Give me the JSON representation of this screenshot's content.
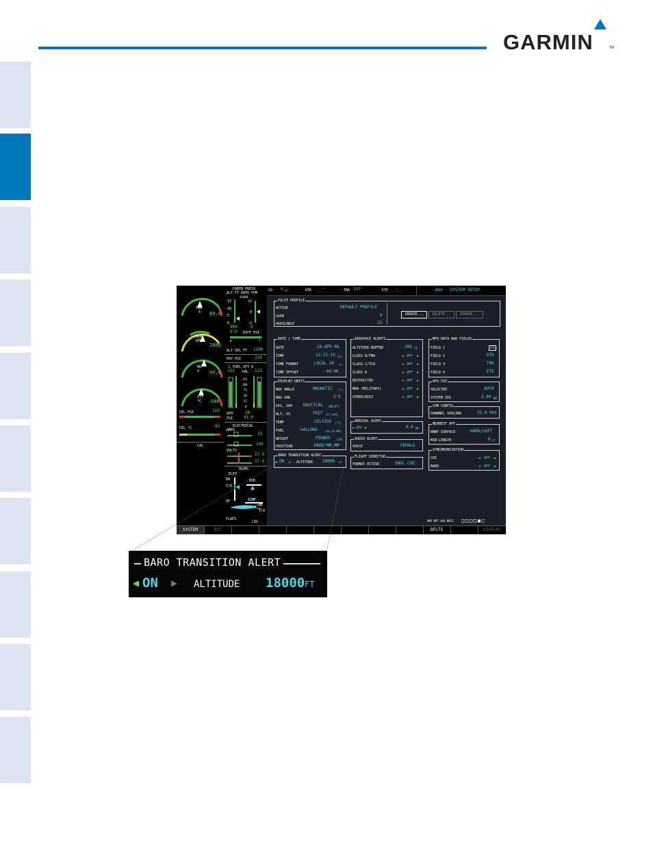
{
  "brand": {
    "logo_text": "GARMIN",
    "trademark": "TM",
    "accent_color": "#0077bd"
  },
  "topbar": {
    "gs_label": "GS",
    "gs_value": "0",
    "gs_unit": "KT",
    "dtk_label": "DTK",
    "dtk_value": "___°",
    "trk_label": "TRK",
    "trk_value": "357°",
    "ete_label": "ETE",
    "ete_value": "__:__",
    "page_title": "AUX - SYSTEM SETUP"
  },
  "eis": {
    "trq": {
      "label": "TRQ",
      "unit": "%",
      "value": "80.0"
    },
    "prop": {
      "label": "PROP",
      "unit": "RPM",
      "value": "2000"
    },
    "ng": {
      "label": "NG",
      "unit": "%",
      "value": "99.0"
    },
    "itt": {
      "label": "ITT",
      "unit": "°C",
      "value": "600"
    },
    "oil_psi": {
      "label": "OIL PSI",
      "value": "110"
    },
    "oil_c": {
      "label": "OIL °C",
      "value": "85"
    },
    "cas_label": "CAS"
  },
  "eis2": {
    "cabin_press": "CABIN PRESS",
    "alt_ft_rate_fpm": "ALT FT RATE FPM",
    "scale_top": "41000",
    "alt_ticks": [
      "15",
      "10",
      "5",
      "0"
    ],
    "rate_ticks": [
      "+2",
      "0",
      "-2"
    ],
    "alt_value": "900",
    "rate_value": "0",
    "diff_psi_value": "0.0",
    "diff_psi_label": "DIFF PSI",
    "diff_scale_low": "0",
    "diff_scale_high": "7",
    "alt_sel_label": "ALT SEL FT",
    "alt_sel_value": "1100",
    "oxy_psi_label": "OXY PSI",
    "oxy_psi_value": "330",
    "fuel_qty_label": "L  FUEL QTY  R",
    "fuel_unit": "GAL",
    "fuel_left": "122",
    "fuel_right": "122",
    "fuel_ticks": [
      "125",
      "100",
      "75",
      "50",
      "25",
      "0"
    ],
    "gph_label": "GPH",
    "gph_value": "20",
    "psi_label": "PSI",
    "psi_value": "41.0",
    "electrical_label": "ELECTRICAL",
    "amps_label": "AMPS",
    "amps_values": [
      "33",
      "100"
    ],
    "volts_label": "VOLTS",
    "volts_values": [
      "27.6",
      "27.6"
    ],
    "trims_label": "TRIMS",
    "elev_label": "ELEV",
    "dn_label": "DN",
    "to_label": "T/O",
    "up_label": "UP",
    "rud_label": "RUD",
    "ail_label": "AIL",
    "flaps_label": "FLAPS",
    "flaps_up": "UP",
    "flaps_to": "T/O",
    "flaps_ldg": "LDG"
  },
  "pilot_profile": {
    "title": "PILOT PROFILE",
    "rows": [
      {
        "label": "ACTIVE",
        "value": "DEFAULT PROFILE"
      },
      {
        "label": "USER",
        "value": "0"
      },
      {
        "label": "AVAILABLE",
        "value": "25"
      }
    ],
    "buttons": [
      "CREATE...",
      "DELETE...",
      "RENAME..."
    ]
  },
  "date_time": {
    "title": "DATE / TIME",
    "rows": [
      {
        "label": "DATE",
        "value": "24-APR-08",
        "unit": ""
      },
      {
        "label": "TIME",
        "value": "13:21:10",
        "unit": "LCL"
      },
      {
        "label": "TIME FORMAT",
        "value": "LOCAL 24",
        "unit": "hr"
      },
      {
        "label": "TIME OFFSET",
        "value": "-08:00",
        "unit": ""
      }
    ]
  },
  "display_units": {
    "title": "DISPLAY UNITS",
    "rows": [
      {
        "label": "NAV ANGLE",
        "value": "MAGNETIC",
        "unit": "(°)"
      },
      {
        "label": "MAG VAR",
        "value": "3°E",
        "unit": ""
      },
      {
        "label": "DIS, SPD",
        "value": "NAUTICAL",
        "unit": "(NM,KT)"
      },
      {
        "label": "ALT, VS",
        "value": "FEET",
        "unit": "(FT,FPM)"
      },
      {
        "label": "TEMP",
        "value": "CELSIUS",
        "unit": "(°C)"
      },
      {
        "label": "FUEL",
        "value": "GALLONS",
        "unit": "(GL,GL/HR)"
      },
      {
        "label": "WEIGHT",
        "value": "POUNDS",
        "unit": "(LB)"
      },
      {
        "label": "POSITION",
        "value": "HDDD°MM.MM'",
        "unit": ""
      }
    ]
  },
  "baro_alert_small": {
    "title": "BARO TRANSITION ALERT",
    "state": "ON",
    "label": "ALTITUDE",
    "value": "18000",
    "unit": "FT"
  },
  "airspace_alerts": {
    "title": "AIRSPACE ALERTS",
    "rows": [
      {
        "label": "ALTITUDE BUFFER",
        "value": "200",
        "unit": "FT"
      },
      {
        "label": "CLASS B/TMA",
        "value": "OFF"
      },
      {
        "label": "CLASS C/TCA",
        "value": "OFF"
      },
      {
        "label": "CLASS D",
        "value": "OFF"
      },
      {
        "label": "RESTRICTED",
        "value": "OFF"
      },
      {
        "label": "MOA (MILITARY)",
        "value": "OFF"
      },
      {
        "label": "OTHER/ADIZ",
        "value": "OFF"
      }
    ]
  },
  "arrival_alert": {
    "title": "ARRIVAL ALERT",
    "state": "OFF",
    "value": "0.0",
    "unit": "NM"
  },
  "audio_alert": {
    "title": "AUDIO ALERT",
    "label": "VOICE",
    "value": "FEMALE"
  },
  "flight_director": {
    "title": "FLIGHT DIRECTOR",
    "label": "FORMAT ACTIVE",
    "value": "SNGL CUE"
  },
  "mfd_data_bar": {
    "title": "MFD DATA BAR FIELDS",
    "rows": [
      {
        "label": "FIELD 1",
        "value": "GS"
      },
      {
        "label": "FIELD 2",
        "value": "DTK"
      },
      {
        "label": "FIELD 3",
        "value": "TRK"
      },
      {
        "label": "FIELD 4",
        "value": "ETE"
      }
    ]
  },
  "gps_cdi": {
    "title": "GPS CDI",
    "rows": [
      {
        "label": "SELECTED",
        "value": "AUTO",
        "unit": ""
      },
      {
        "label": "SYSTEM CDI",
        "value": "2.00",
        "unit": "NM"
      }
    ]
  },
  "com_config": {
    "title": "COM CONFIG",
    "label": "CHANNEL SPACING",
    "value": "25.0 kHz"
  },
  "nearest_apt": {
    "title": "NEAREST APT",
    "rows": [
      {
        "label": "RNWY SURFACE",
        "value": "HARD/SOFT",
        "unit": ""
      },
      {
        "label": "MIN LENGTH",
        "value": "0",
        "unit": "FT"
      }
    ]
  },
  "synchronization": {
    "title": "SYNCHRONIZATION",
    "rows": [
      {
        "label": "CDI",
        "value": "OFF"
      },
      {
        "label": "BARO",
        "value": "OFF"
      }
    ]
  },
  "page_group": {
    "labels": "MAP WPT AUX NRST"
  },
  "softkeys": [
    {
      "label": "SYSTEM",
      "active": true
    },
    {
      "label": "RST",
      "active": false
    },
    {
      "label": "",
      "active": false
    },
    {
      "label": "",
      "active": false
    },
    {
      "label": "",
      "active": false
    },
    {
      "label": "",
      "active": false
    },
    {
      "label": "",
      "active": false
    },
    {
      "label": "",
      "active": false
    },
    {
      "label": "",
      "active": false
    },
    {
      "label": "DFLTS",
      "active": true
    },
    {
      "label": "",
      "active": false
    },
    {
      "label": "DISPLAY",
      "active": false
    }
  ],
  "callout": {
    "title": "BARO TRANSITION ALERT",
    "state": "ON",
    "label": "ALTITUDE",
    "value": "18000",
    "unit": "FT"
  }
}
